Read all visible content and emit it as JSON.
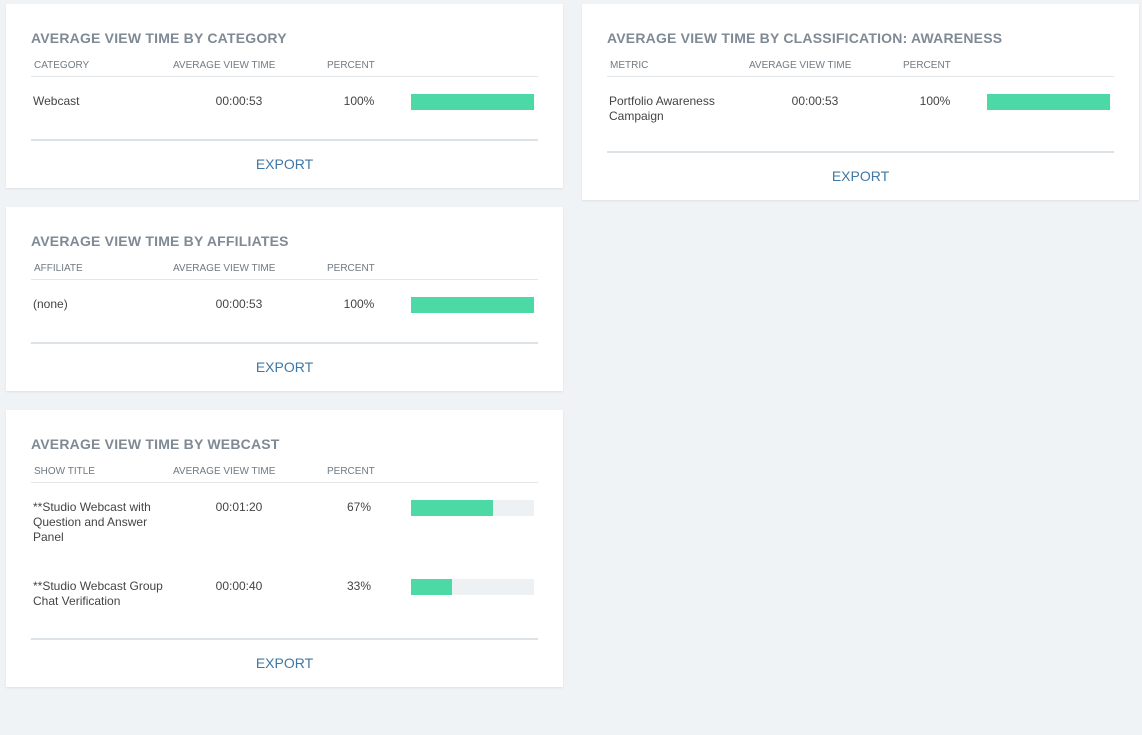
{
  "cards": {
    "category": {
      "title": "AVERAGE VIEW TIME BY CATEGORY",
      "headers": [
        "CATEGORY",
        "AVERAGE VIEW TIME",
        "PERCENT"
      ],
      "rows": [
        {
          "label": "Webcast",
          "time": "00:00:53",
          "percent_text": "100%",
          "percent": 100
        }
      ],
      "export": "EXPORT"
    },
    "affiliates": {
      "title": "AVERAGE VIEW TIME BY AFFILIATES",
      "headers": [
        "AFFILIATE",
        "AVERAGE VIEW TIME",
        "PERCENT"
      ],
      "rows": [
        {
          "label": "(none)",
          "time": "00:00:53",
          "percent_text": "100%",
          "percent": 100
        }
      ],
      "export": "EXPORT"
    },
    "webcast": {
      "title": "AVERAGE VIEW TIME BY WEBCAST",
      "headers": [
        "SHOW TITLE",
        "AVERAGE VIEW TIME",
        "PERCENT"
      ],
      "rows": [
        {
          "label": "**Studio Webcast with Question and Answer Panel",
          "time": "00:01:20",
          "percent_text": "67%",
          "percent": 67
        },
        {
          "label": "**Studio Webcast Group Chat Verification",
          "time": "00:00:40",
          "percent_text": "33%",
          "percent": 33
        }
      ],
      "export": "EXPORT"
    },
    "classification": {
      "title": "AVERAGE VIEW TIME BY CLASSIFICATION: AWARENESS",
      "headers": [
        "METRIC",
        "AVERAGE VIEW TIME",
        "PERCENT"
      ],
      "rows": [
        {
          "label": "Portfolio Awareness Campaign",
          "time": "00:00:53",
          "percent_text": "100%",
          "percent": 100
        }
      ],
      "export": "EXPORT"
    }
  },
  "colors": {
    "bar_fill": "#4dd9a5",
    "bar_track": "#eef1f4",
    "export_link": "#3f78a6",
    "title": "#7f8a94"
  }
}
